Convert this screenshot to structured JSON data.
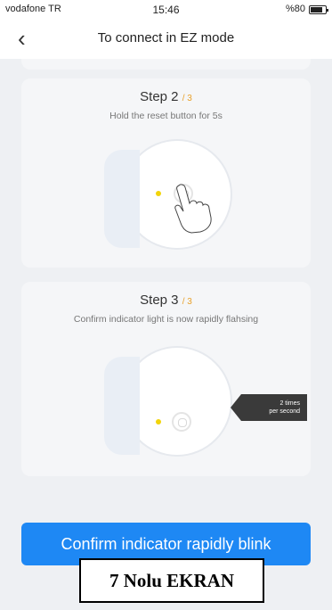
{
  "status_bar": {
    "carrier": "vodafone TR",
    "time": "15:46",
    "battery_text": "%80",
    "battery_level": 0.8
  },
  "nav": {
    "back_icon": "chevron-left-icon",
    "title": "To connect in EZ mode"
  },
  "steps": [
    {
      "label": "Step 2",
      "total": "/ 3",
      "description": "Hold the reset button for 5s"
    },
    {
      "label": "Step 3",
      "total": "/ 3",
      "description": "Confirm indicator light is now rapidly flahsing",
      "badge_line1": "2 times",
      "badge_line2": "per second"
    }
  ],
  "confirm_button": "Confirm indicator rapidly blink",
  "footer_label": "7 Nolu EKRAN",
  "colors": {
    "accent": "#1e88f4",
    "indicator": "#f2d40a",
    "step_total": "#e8a12c"
  }
}
